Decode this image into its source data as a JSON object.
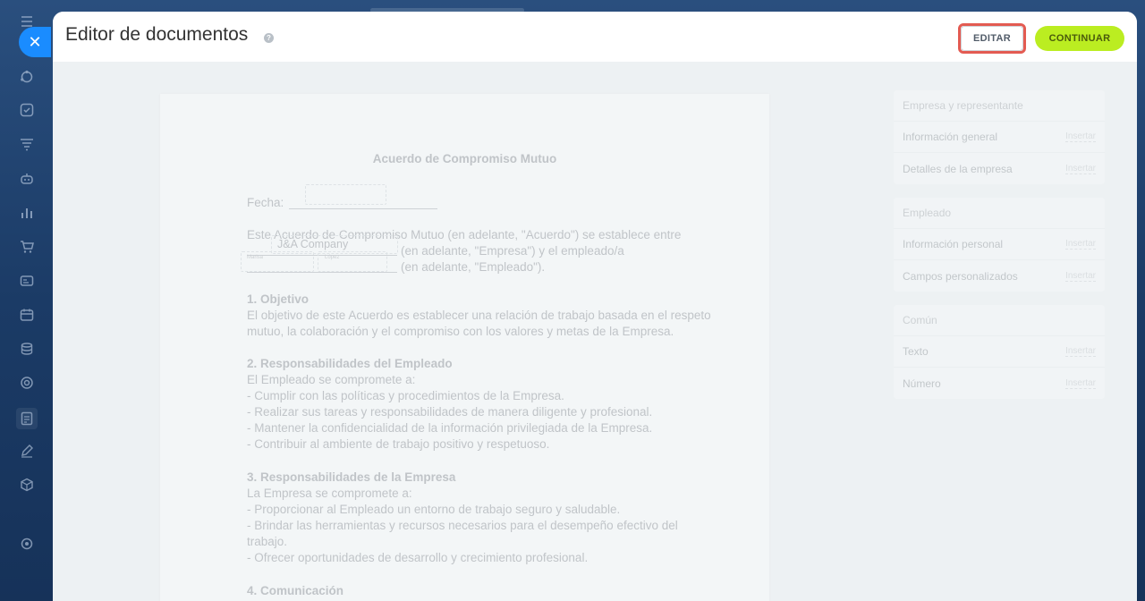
{
  "header": {
    "title": "Editor de documentos",
    "edit_label": "EDITAR",
    "continue_label": "CONTINUAR"
  },
  "document": {
    "title": "Acuerdo de Compromiso Mutuo",
    "date_label": "Fecha:",
    "intro_line1": "Este Acuerdo de Compromiso Mutuo (en adelante, \"Acuerdo\") se establece entre",
    "company_field": "J&A Company",
    "intro_line2": "(en adelante, \"Empresa\") y el empleado/a",
    "first_name_label": "Marisa",
    "last_name_label": "López",
    "intro_line3": "(en adelante, \"Empleado\").",
    "s1_title": "1. Objetivo",
    "s1_l1": "El objetivo de este Acuerdo es establecer una relación de trabajo basada en el respeto",
    "s1_l2": "mutuo, la colaboración y el compromiso con los valores y metas de la Empresa.",
    "s2_title": "2. Responsabilidades del Empleado",
    "s2_l1": "El Empleado se compromete a:",
    "s2_l2": "- Cumplir con las políticas y procedimientos de la Empresa.",
    "s2_l3": "- Realizar sus tareas y responsabilidades de manera diligente y profesional.",
    "s2_l4": "- Mantener la confidencialidad de la información privilegiada de la Empresa.",
    "s2_l5": "- Contribuir al ambiente de trabajo positivo y respetuoso.",
    "s3_title": "3. Responsabilidades de la Empresa",
    "s3_l1": "La Empresa se compromete a:",
    "s3_l2": "- Proporcionar al Empleado un entorno de trabajo seguro y saludable.",
    "s3_l3": "- Brindar las herramientas y recursos necesarios para el desempeño efectivo del",
    "s3_l4": "trabajo.",
    "s3_l5": "- Ofrecer oportunidades de desarrollo y crecimiento profesional.",
    "s4_title": "4. Comunicación"
  },
  "panels": [
    {
      "head": "Empresa y representante",
      "rows": [
        {
          "label": "Información general",
          "action": "Insertar"
        },
        {
          "label": "Detalles de la empresa",
          "action": "Insertar"
        }
      ]
    },
    {
      "head": "Empleado",
      "rows": [
        {
          "label": "Información personal",
          "action": "Insertar"
        },
        {
          "label": "Campos personalizados",
          "action": "Insertar"
        }
      ]
    },
    {
      "head": "Común",
      "rows": [
        {
          "label": "Texto",
          "action": "Insertar"
        },
        {
          "label": "Número",
          "action": "Insertar"
        }
      ]
    }
  ],
  "icons": [
    "close-icon",
    "help-icon",
    "menu-icon",
    "crm-icon",
    "tasks-icon",
    "filter-icon",
    "robot-icon",
    "analytics-icon",
    "cart-icon",
    "contacts-icon",
    "calendar-icon",
    "storage-icon",
    "target-icon",
    "documents-icon",
    "sign-icon",
    "box-icon",
    "settings-icon"
  ],
  "colors": {
    "accent": "#bbed21",
    "close": "#1a8cff",
    "highlight": "#e35b52"
  }
}
